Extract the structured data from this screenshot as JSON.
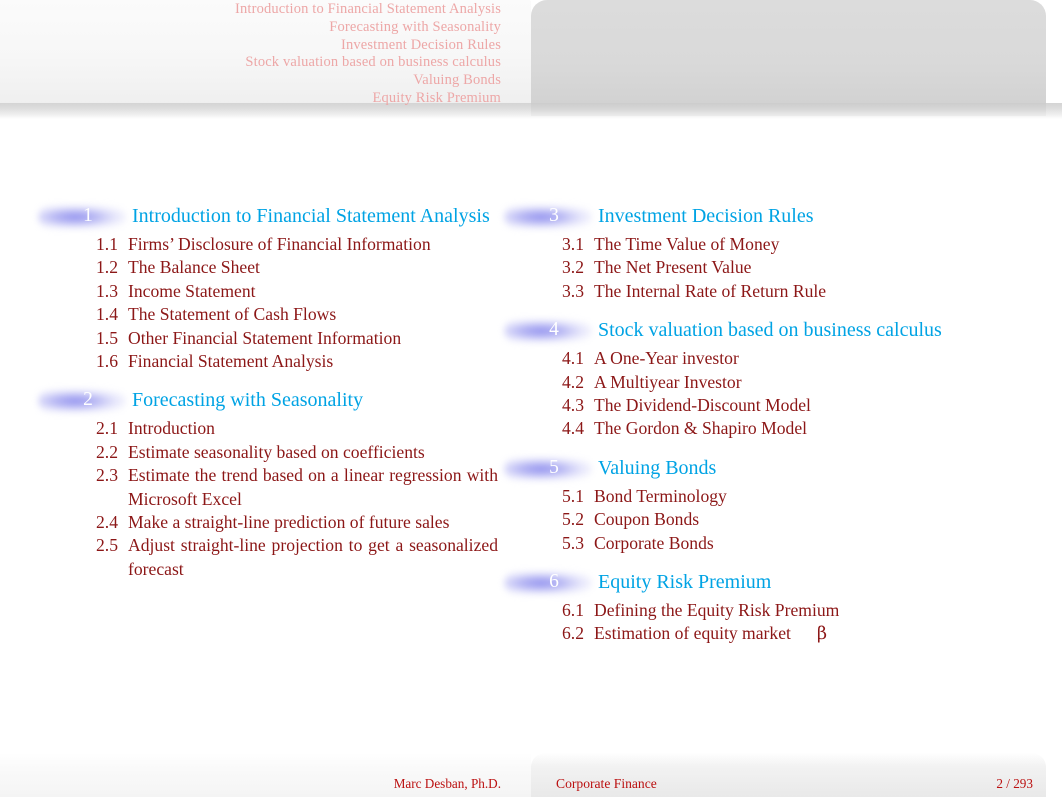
{
  "colors": {
    "nav_text": "#eda7a7",
    "section_title": "#00a3e4",
    "subsection_text": "#8c1717",
    "section_number_text": "#ffffff",
    "section_bullet": "#8c8cee",
    "footer_text": "#bb1111",
    "page_background": "#ffffff",
    "header_left_panel": "#f7f7f7",
    "header_right_panel": "#d9d9d9"
  },
  "header": {
    "nav_sections": [
      "Introduction to Financial Statement Analysis",
      "Forecasting with Seasonality",
      "Investment Decision Rules",
      "Stock valuation based on business calculus",
      "Valuing Bonds",
      "Equity Risk Premium"
    ]
  },
  "toc": {
    "left_column": [
      {
        "number": "1",
        "title": "Introduction to Financial Statement Analysis",
        "subsections": [
          {
            "number": "1.1",
            "title": "Firms’ Disclosure of Financial Information"
          },
          {
            "number": "1.2",
            "title": "The Balance Sheet"
          },
          {
            "number": "1.3",
            "title": "Income Statement"
          },
          {
            "number": "1.4",
            "title": "The Statement of Cash Flows"
          },
          {
            "number": "1.5",
            "title": "Other Financial Statement Information"
          },
          {
            "number": "1.6",
            "title": "Financial Statement Analysis"
          }
        ]
      },
      {
        "number": "2",
        "title": "Forecasting with Seasonality",
        "subsections": [
          {
            "number": "2.1",
            "title": "Introduction"
          },
          {
            "number": "2.2",
            "title": "Estimate seasonality based on coefficients"
          },
          {
            "number": "2.3",
            "title": "Estimate the trend based on a linear regression with Microsoft Excel"
          },
          {
            "number": "2.4",
            "title": "Make a straight-line prediction of future sales"
          },
          {
            "number": "2.5",
            "title": "Adjust straight-line projection to get a seasonalized forecast"
          }
        ]
      }
    ],
    "right_column": [
      {
        "number": "3",
        "title": "Investment Decision Rules",
        "subsections": [
          {
            "number": "3.1",
            "title": "The Time Value of Money"
          },
          {
            "number": "3.2",
            "title": "The Net Present Value"
          },
          {
            "number": "3.3",
            "title": "The Internal Rate of Return Rule"
          }
        ]
      },
      {
        "number": "4",
        "title": "Stock valuation based on business calculus",
        "subsections": [
          {
            "number": "4.1",
            "title": "A One-Year investor"
          },
          {
            "number": "4.2",
            "title": "A Multiyear Investor"
          },
          {
            "number": "4.3",
            "title": "The Dividend-Discount Model"
          },
          {
            "number": "4.4",
            "title": "The Gordon & Shapiro Model"
          }
        ]
      },
      {
        "number": "5",
        "title": "Valuing Bonds",
        "subsections": [
          {
            "number": "5.1",
            "title": "Bond Terminology"
          },
          {
            "number": "5.2",
            "title": "Coupon Bonds"
          },
          {
            "number": "5.3",
            "title": "Corporate Bonds"
          }
        ]
      },
      {
        "number": "6",
        "title": "Equity Risk Premium",
        "subsections": [
          {
            "number": "6.1",
            "title": "Defining the Equity Risk Premium"
          },
          {
            "number": "6.2",
            "title": "Estimation of equity market",
            "suffix": "β"
          }
        ]
      }
    ]
  },
  "footer": {
    "author": "Marc Desban, Ph.D.",
    "title": "Corporate Finance",
    "page": "2 / 293"
  }
}
